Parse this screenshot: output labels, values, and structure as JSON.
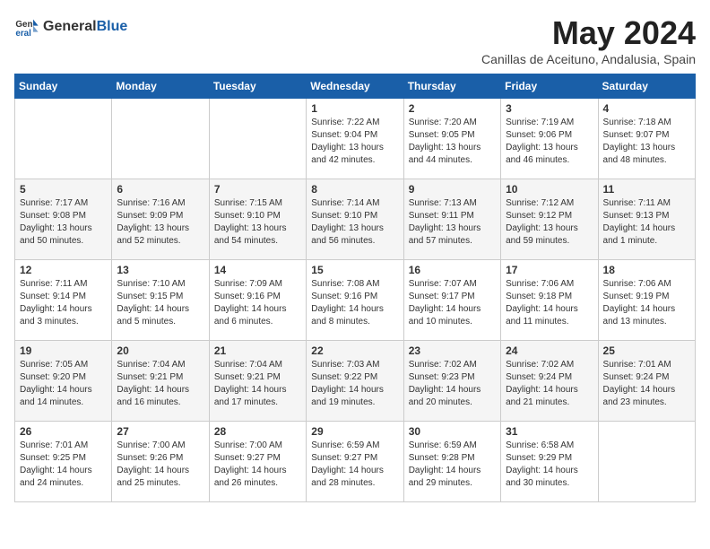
{
  "header": {
    "logo_general": "General",
    "logo_blue": "Blue",
    "title": "May 2024",
    "subtitle": "Canillas de Aceituno, Andalusia, Spain"
  },
  "days_of_week": [
    "Sunday",
    "Monday",
    "Tuesday",
    "Wednesday",
    "Thursday",
    "Friday",
    "Saturday"
  ],
  "weeks": [
    [
      {
        "day": "",
        "content": ""
      },
      {
        "day": "",
        "content": ""
      },
      {
        "day": "",
        "content": ""
      },
      {
        "day": "1",
        "content": "Sunrise: 7:22 AM\nSunset: 9:04 PM\nDaylight: 13 hours\nand 42 minutes."
      },
      {
        "day": "2",
        "content": "Sunrise: 7:20 AM\nSunset: 9:05 PM\nDaylight: 13 hours\nand 44 minutes."
      },
      {
        "day": "3",
        "content": "Sunrise: 7:19 AM\nSunset: 9:06 PM\nDaylight: 13 hours\nand 46 minutes."
      },
      {
        "day": "4",
        "content": "Sunrise: 7:18 AM\nSunset: 9:07 PM\nDaylight: 13 hours\nand 48 minutes."
      }
    ],
    [
      {
        "day": "5",
        "content": "Sunrise: 7:17 AM\nSunset: 9:08 PM\nDaylight: 13 hours\nand 50 minutes."
      },
      {
        "day": "6",
        "content": "Sunrise: 7:16 AM\nSunset: 9:09 PM\nDaylight: 13 hours\nand 52 minutes."
      },
      {
        "day": "7",
        "content": "Sunrise: 7:15 AM\nSunset: 9:10 PM\nDaylight: 13 hours\nand 54 minutes."
      },
      {
        "day": "8",
        "content": "Sunrise: 7:14 AM\nSunset: 9:10 PM\nDaylight: 13 hours\nand 56 minutes."
      },
      {
        "day": "9",
        "content": "Sunrise: 7:13 AM\nSunset: 9:11 PM\nDaylight: 13 hours\nand 57 minutes."
      },
      {
        "day": "10",
        "content": "Sunrise: 7:12 AM\nSunset: 9:12 PM\nDaylight: 13 hours\nand 59 minutes."
      },
      {
        "day": "11",
        "content": "Sunrise: 7:11 AM\nSunset: 9:13 PM\nDaylight: 14 hours\nand 1 minute."
      }
    ],
    [
      {
        "day": "12",
        "content": "Sunrise: 7:11 AM\nSunset: 9:14 PM\nDaylight: 14 hours\nand 3 minutes."
      },
      {
        "day": "13",
        "content": "Sunrise: 7:10 AM\nSunset: 9:15 PM\nDaylight: 14 hours\nand 5 minutes."
      },
      {
        "day": "14",
        "content": "Sunrise: 7:09 AM\nSunset: 9:16 PM\nDaylight: 14 hours\nand 6 minutes."
      },
      {
        "day": "15",
        "content": "Sunrise: 7:08 AM\nSunset: 9:16 PM\nDaylight: 14 hours\nand 8 minutes."
      },
      {
        "day": "16",
        "content": "Sunrise: 7:07 AM\nSunset: 9:17 PM\nDaylight: 14 hours\nand 10 minutes."
      },
      {
        "day": "17",
        "content": "Sunrise: 7:06 AM\nSunset: 9:18 PM\nDaylight: 14 hours\nand 11 minutes."
      },
      {
        "day": "18",
        "content": "Sunrise: 7:06 AM\nSunset: 9:19 PM\nDaylight: 14 hours\nand 13 minutes."
      }
    ],
    [
      {
        "day": "19",
        "content": "Sunrise: 7:05 AM\nSunset: 9:20 PM\nDaylight: 14 hours\nand 14 minutes."
      },
      {
        "day": "20",
        "content": "Sunrise: 7:04 AM\nSunset: 9:21 PM\nDaylight: 14 hours\nand 16 minutes."
      },
      {
        "day": "21",
        "content": "Sunrise: 7:04 AM\nSunset: 9:21 PM\nDaylight: 14 hours\nand 17 minutes."
      },
      {
        "day": "22",
        "content": "Sunrise: 7:03 AM\nSunset: 9:22 PM\nDaylight: 14 hours\nand 19 minutes."
      },
      {
        "day": "23",
        "content": "Sunrise: 7:02 AM\nSunset: 9:23 PM\nDaylight: 14 hours\nand 20 minutes."
      },
      {
        "day": "24",
        "content": "Sunrise: 7:02 AM\nSunset: 9:24 PM\nDaylight: 14 hours\nand 21 minutes."
      },
      {
        "day": "25",
        "content": "Sunrise: 7:01 AM\nSunset: 9:24 PM\nDaylight: 14 hours\nand 23 minutes."
      }
    ],
    [
      {
        "day": "26",
        "content": "Sunrise: 7:01 AM\nSunset: 9:25 PM\nDaylight: 14 hours\nand 24 minutes."
      },
      {
        "day": "27",
        "content": "Sunrise: 7:00 AM\nSunset: 9:26 PM\nDaylight: 14 hours\nand 25 minutes."
      },
      {
        "day": "28",
        "content": "Sunrise: 7:00 AM\nSunset: 9:27 PM\nDaylight: 14 hours\nand 26 minutes."
      },
      {
        "day": "29",
        "content": "Sunrise: 6:59 AM\nSunset: 9:27 PM\nDaylight: 14 hours\nand 28 minutes."
      },
      {
        "day": "30",
        "content": "Sunrise: 6:59 AM\nSunset: 9:28 PM\nDaylight: 14 hours\nand 29 minutes."
      },
      {
        "day": "31",
        "content": "Sunrise: 6:58 AM\nSunset: 9:29 PM\nDaylight: 14 hours\nand 30 minutes."
      },
      {
        "day": "",
        "content": ""
      }
    ]
  ]
}
